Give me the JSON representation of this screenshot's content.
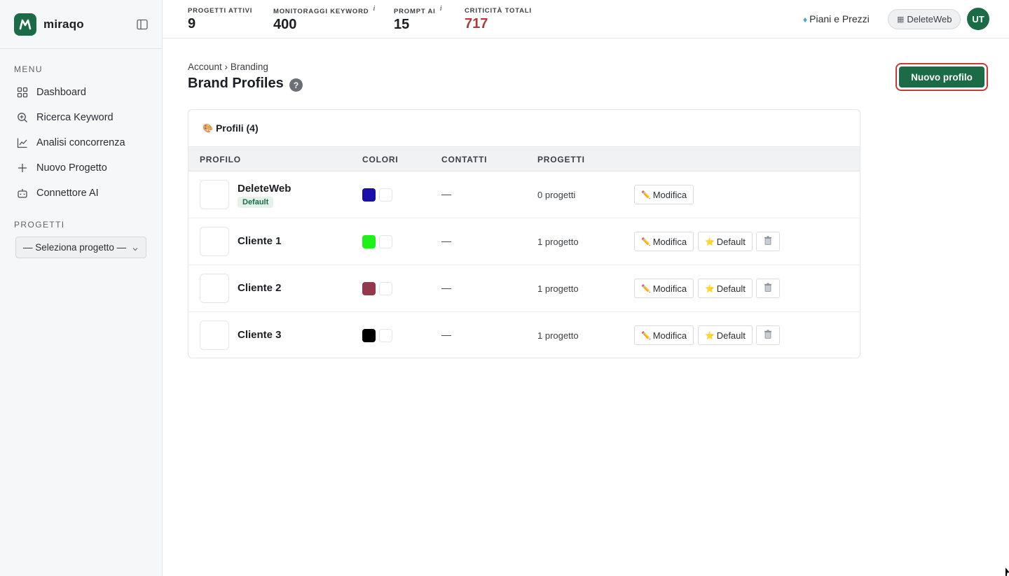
{
  "brand": {
    "name": "miraqo"
  },
  "sidebar": {
    "menu_title": "MENU",
    "items": [
      {
        "label": "Dashboard",
        "icon": "grid-icon"
      },
      {
        "label": "Ricerca Keyword",
        "icon": "search-icon"
      },
      {
        "label": "Analisi concorrenza",
        "icon": "line-chart-icon"
      },
      {
        "label": "Nuovo Progetto",
        "icon": "plus-icon"
      },
      {
        "label": "Connettore AI",
        "icon": "robot-icon"
      }
    ],
    "projects_title": "PROGETTI",
    "project_select": "— Seleziona progetto —"
  },
  "stats": [
    {
      "label": "PROGETTI ATTIVI",
      "value": "9",
      "info": ""
    },
    {
      "label": "MONITORAGGI KEYWORD",
      "value": "400",
      "info": "i"
    },
    {
      "label": "PROMPT AI",
      "value": "15",
      "info": "i"
    },
    {
      "label": "CRITICITÀ TOTALI",
      "value": "717",
      "info": ""
    }
  ],
  "topbar": {
    "plans_label": "Piani e Prezzi",
    "org_label": "DeleteWeb",
    "avatar_initials": "UT"
  },
  "page": {
    "breadcrumb_parent": "Account",
    "breadcrumb_sep": "›",
    "breadcrumb_current": "Branding",
    "title": "Brand Profiles",
    "help": "?",
    "new_profile_label": "Nuovo profilo"
  },
  "card": {
    "title": "Profili (4)",
    "columns": [
      "PROFILO",
      "COLORI",
      "CONTATTI",
      "PROGETTI"
    ],
    "default_badge": "Default",
    "edit_label": "Modifica",
    "set_default_label": "Default",
    "rows": [
      {
        "name": "DeleteWeb",
        "primary": "#1a0fa8",
        "contacts": "—",
        "projects": "0 progetti",
        "is_default": true
      },
      {
        "name": "Cliente 1",
        "primary": "#1ef01a",
        "contacts": "—",
        "projects": "1 progetto",
        "is_default": false
      },
      {
        "name": "Cliente 2",
        "primary": "#94384e",
        "contacts": "—",
        "projects": "1 progetto",
        "is_default": false
      },
      {
        "name": "Cliente 3",
        "primary": "#000000",
        "contacts": "—",
        "projects": "1 progetto",
        "is_default": false
      }
    ]
  },
  "colors": {
    "accent": "#1b6b46",
    "danger": "#b33a3a",
    "highlight": "#c13b3b"
  }
}
